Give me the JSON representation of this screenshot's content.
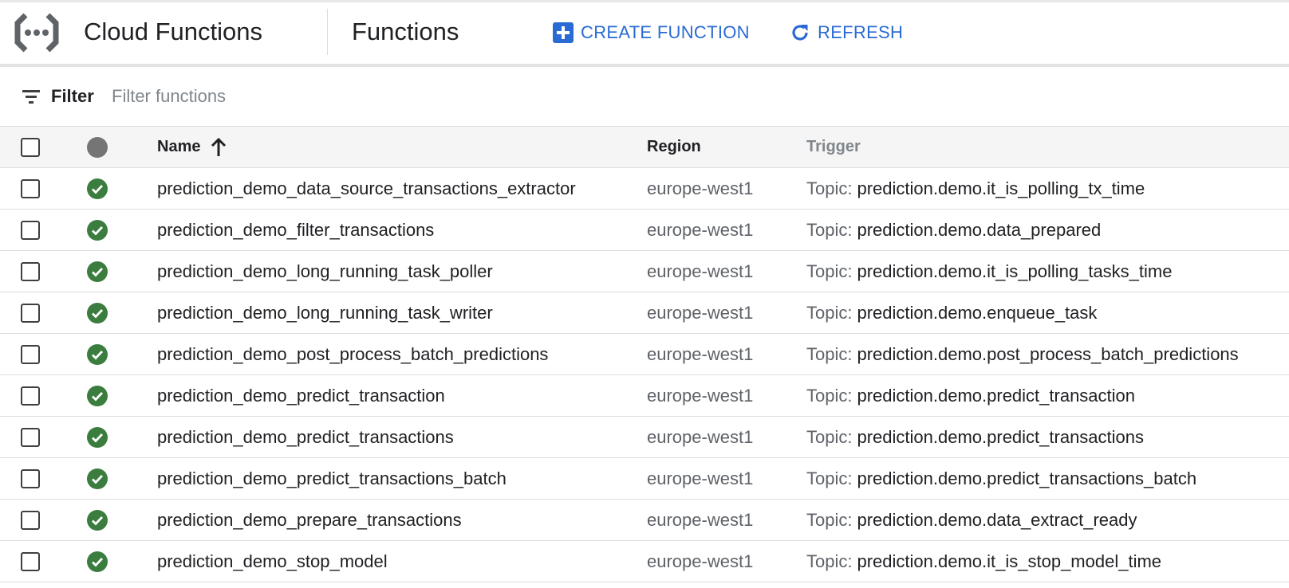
{
  "header": {
    "product_title": "Cloud Functions",
    "page_title": "Functions",
    "create_label": "CREATE FUNCTION",
    "refresh_label": "REFRESH",
    "accent_color": "#2a6ad4"
  },
  "filter": {
    "label": "Filter",
    "placeholder": "Filter functions"
  },
  "table": {
    "columns": {
      "name": "Name",
      "region": "Region",
      "trigger": "Trigger"
    },
    "sort": {
      "column": "name",
      "direction": "ascending"
    },
    "status_ok_color": "#3a7d3e",
    "rows": [
      {
        "name": "prediction_demo_data_source_transactions_extractor",
        "region": "europe-west1",
        "trigger_type": "Topic:",
        "trigger_value": "prediction.demo.it_is_polling_tx_time",
        "status": "ok"
      },
      {
        "name": "prediction_demo_filter_transactions",
        "region": "europe-west1",
        "trigger_type": "Topic:",
        "trigger_value": "prediction.demo.data_prepared",
        "status": "ok"
      },
      {
        "name": "prediction_demo_long_running_task_poller",
        "region": "europe-west1",
        "trigger_type": "Topic:",
        "trigger_value": "prediction.demo.it_is_polling_tasks_time",
        "status": "ok"
      },
      {
        "name": "prediction_demo_long_running_task_writer",
        "region": "europe-west1",
        "trigger_type": "Topic:",
        "trigger_value": "prediction.demo.enqueue_task",
        "status": "ok"
      },
      {
        "name": "prediction_demo_post_process_batch_predictions",
        "region": "europe-west1",
        "trigger_type": "Topic:",
        "trigger_value": "prediction.demo.post_process_batch_predictions",
        "status": "ok"
      },
      {
        "name": "prediction_demo_predict_transaction",
        "region": "europe-west1",
        "trigger_type": "Topic:",
        "trigger_value": "prediction.demo.predict_transaction",
        "status": "ok"
      },
      {
        "name": "prediction_demo_predict_transactions",
        "region": "europe-west1",
        "trigger_type": "Topic:",
        "trigger_value": "prediction.demo.predict_transactions",
        "status": "ok"
      },
      {
        "name": "prediction_demo_predict_transactions_batch",
        "region": "europe-west1",
        "trigger_type": "Topic:",
        "trigger_value": "prediction.demo.predict_transactions_batch",
        "status": "ok"
      },
      {
        "name": "prediction_demo_prepare_transactions",
        "region": "europe-west1",
        "trigger_type": "Topic:",
        "trigger_value": "prediction.demo.data_extract_ready",
        "status": "ok"
      },
      {
        "name": "prediction_demo_stop_model",
        "region": "europe-west1",
        "trigger_type": "Topic:",
        "trigger_value": "prediction.demo.it_is_stop_model_time",
        "status": "ok"
      }
    ]
  },
  "icons": {
    "logo": "cloud-functions-logo-icon",
    "create": "add-box-icon",
    "refresh": "refresh-icon",
    "filter": "filter-list-icon",
    "sort": "arrow-up-icon",
    "status_header": "status-dot-icon",
    "status_ok": "check-circle-icon"
  }
}
